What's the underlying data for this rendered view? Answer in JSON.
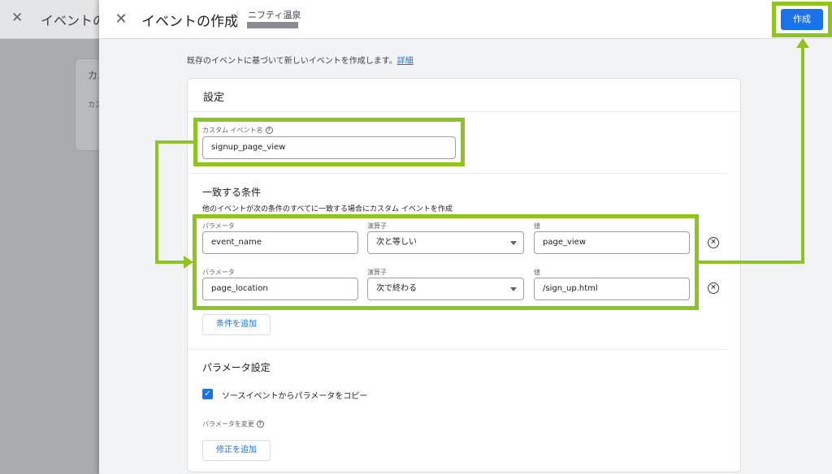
{
  "background": {
    "title": "イベントの",
    "card_title": "カ.",
    "card_sub": "カス"
  },
  "header": {
    "title": "イベントの作成",
    "account_name": "ニフティ温泉",
    "create_label": "作成"
  },
  "intro": {
    "text": "既存のイベントに基づいて新しいイベントを作成します。",
    "link": "詳細"
  },
  "settings": {
    "title": "設定",
    "custom_event_label": "カスタム イベント名",
    "custom_event_value": "signup_page_view"
  },
  "conditions": {
    "title": "一致する条件",
    "description": "他のイベントが次の条件のすべてに一致する場合にカスタム イベントを作成",
    "col_param": "パラメータ",
    "col_operator": "演算子",
    "col_value": "値",
    "rows": [
      {
        "param": "event_name",
        "operator": "次と等しい",
        "value": "page_view"
      },
      {
        "param": "page_location",
        "operator": "次で終わる",
        "value": "/sign_up.html"
      }
    ],
    "add_label": "条件を追加"
  },
  "param_settings": {
    "title": "パラメータ設定",
    "copy_label": "ソースイベントからパラメータをコピー",
    "copy_checked": true,
    "modify_label": "パラメータを変更",
    "add_modification_label": "修正を追加"
  },
  "colors": {
    "accent": "#1a73e8",
    "highlight": "#8fc31f"
  }
}
